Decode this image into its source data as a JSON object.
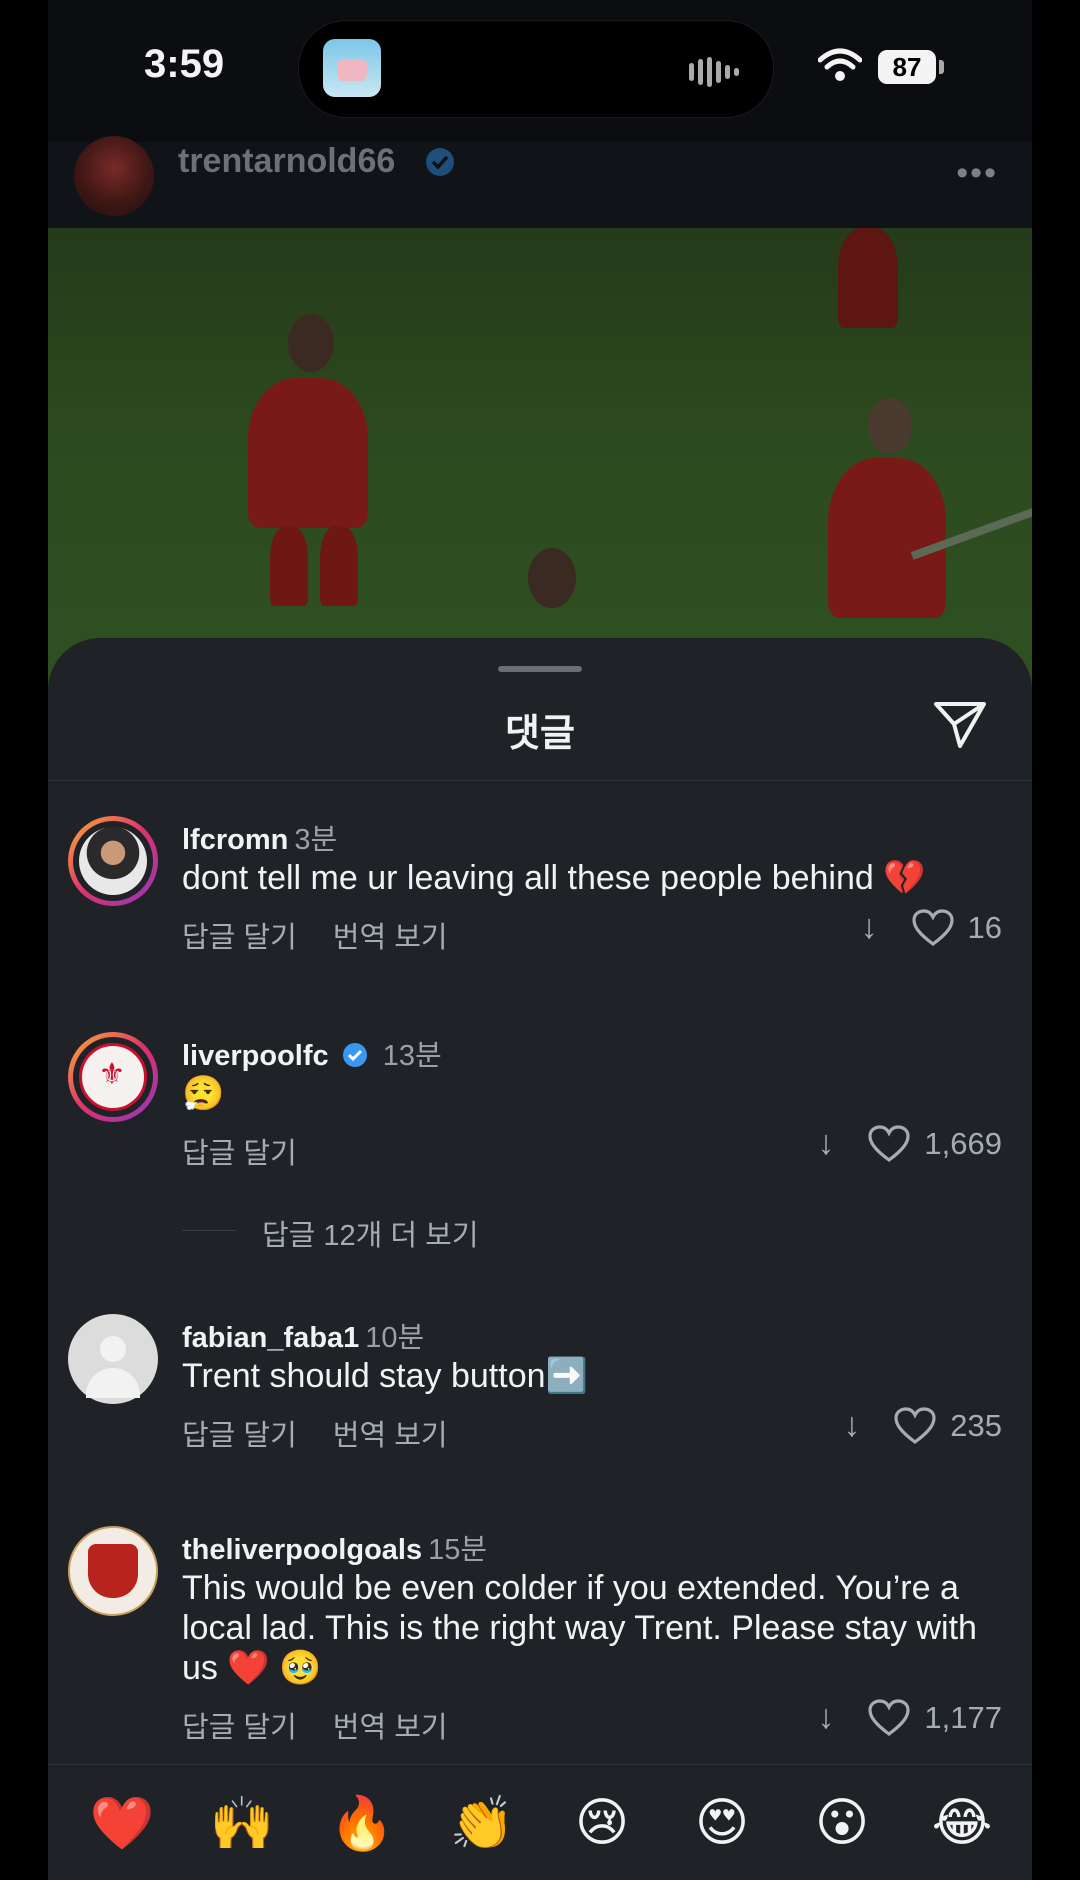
{
  "status_bar": {
    "time": "3:59",
    "battery": "87"
  },
  "post": {
    "username": "trentarnold66",
    "more": "•••"
  },
  "sheet": {
    "title": "댓글"
  },
  "comments": [
    {
      "username": "lfcromn",
      "time": "3분",
      "text": "dont tell me ur leaving all these people behind 💔",
      "reply": "답글 달기",
      "translate": "번역 보기",
      "likes": "16"
    },
    {
      "username": "liverpoolfc",
      "time": "13분",
      "text": "😮‍💨",
      "reply": "답글 달기",
      "likes": "1,669",
      "more_replies": "답글 12개 더 보기"
    },
    {
      "username": "fabian_faba1",
      "time": "10분",
      "text": "Trent should stay button➡️",
      "reply": "답글 달기",
      "translate": "번역 보기",
      "likes": "235"
    },
    {
      "username": "theliverpoolgoals",
      "time": "15분",
      "text": "This would be even colder if you extended. You’re a local lad. This is the right way Trent. Please stay with us ❤️ 🥹",
      "reply": "답글 달기",
      "translate": "번역 보기",
      "likes": "1,177"
    }
  ],
  "reactions": [
    "❤️",
    "🙌",
    "🔥",
    "👏",
    "😢",
    "😍",
    "😮",
    "😂"
  ],
  "icons": {
    "share": "send-icon",
    "heart": "heart-outline-icon",
    "down": "arrow-down-icon",
    "verified": "verified-badge-icon"
  }
}
